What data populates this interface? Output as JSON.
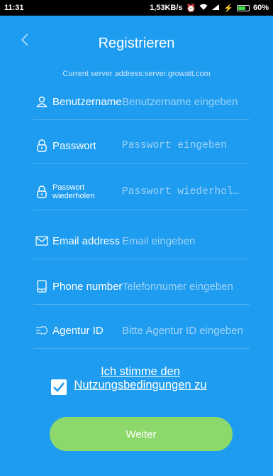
{
  "status_bar": {
    "time": "11:31",
    "speed": "1,53KB/s",
    "battery": "60%"
  },
  "header": {
    "title": "Registrieren"
  },
  "server_address": "Current server address:server.growatt.com",
  "fields": {
    "username": {
      "label": "Benutzername",
      "placeholder": "Benutzername eingeben"
    },
    "password": {
      "label": "Passwort",
      "placeholder": "Passwort eingeben"
    },
    "password_repeat": {
      "label": "Passwort wiederholen",
      "placeholder": "Passwort wiederhol…"
    },
    "email": {
      "label": "Email address",
      "placeholder": "Email eingeben"
    },
    "phone": {
      "label": "Phone number",
      "placeholder": "Telefonnumer eingeben"
    },
    "agency": {
      "label": "Agentur ID",
      "placeholder": "Bitte Agentur ID eingeben"
    }
  },
  "agreement": {
    "text": "Ich stimme den Nutzungsbedingungen zu",
    "checked": true
  },
  "submit_label": "Weiter",
  "colors": {
    "background": "#1d9cf0",
    "button": "#8dd86a"
  }
}
